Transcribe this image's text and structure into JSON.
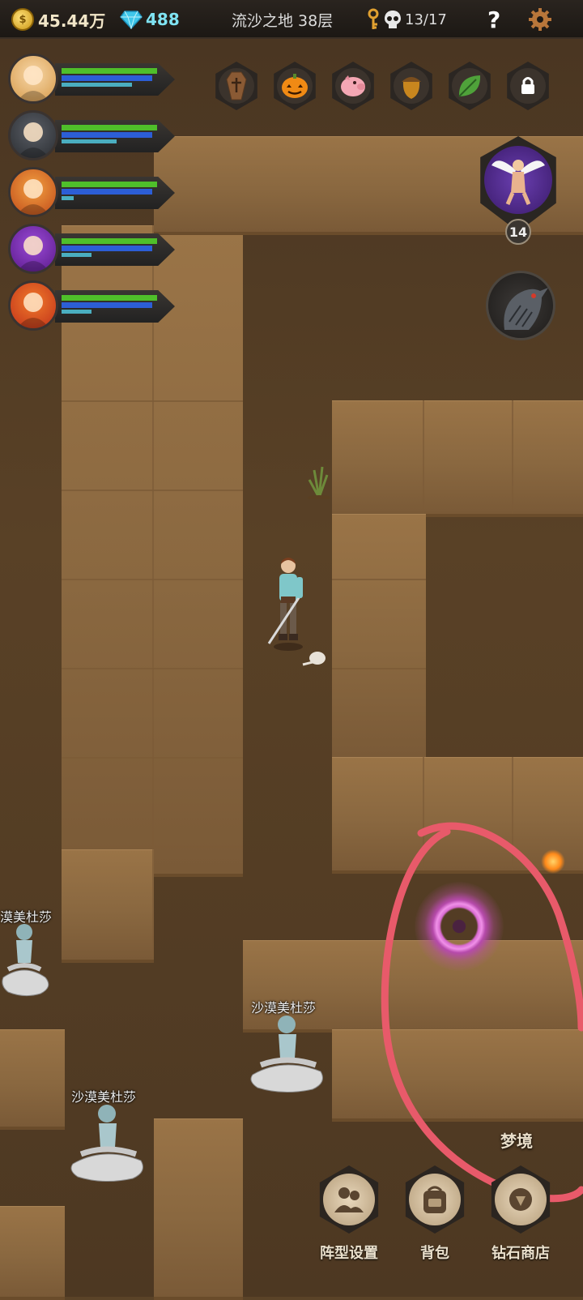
{
  "top_bar": {
    "gold": "45.44万",
    "gold_symbol": "$",
    "diamonds": "488",
    "location": "流沙之地 38层",
    "kills": "13/17",
    "help": "?"
  },
  "heroes": [
    {
      "name": "hero-1",
      "hp": 0.95,
      "mp": 0.9,
      "xp": 0.7
    },
    {
      "name": "hero-2",
      "hp": 0.95,
      "mp": 0.9,
      "xp": 0.55
    },
    {
      "name": "hero-3",
      "hp": 0.95,
      "mp": 0.9,
      "xp": 0.12
    },
    {
      "name": "hero-4",
      "hp": 0.95,
      "mp": 0.9,
      "xp": 0.3
    },
    {
      "name": "hero-5",
      "hp": 0.95,
      "mp": 0.9,
      "xp": 0.3
    }
  ],
  "skills": [
    "coffin-icon",
    "pumpkin-icon",
    "pig-icon",
    "acorn-icon",
    "leaf-icon",
    "lock-icon"
  ],
  "companion_level": "14",
  "enemies": [
    {
      "name": "漠美杜莎"
    },
    {
      "name": "沙漠美杜莎"
    },
    {
      "name": "沙漠美杜莎"
    }
  ],
  "portal_label": "梦境",
  "buttons": [
    {
      "label": "阵型设置",
      "icon": "formation-icon"
    },
    {
      "label": "背包",
      "icon": "backpack-icon"
    },
    {
      "label": "钻石商店",
      "icon": "diamond-shop-icon"
    }
  ],
  "colors": {
    "annotation": "#e85a6a",
    "hp": "#4fbf2a",
    "mp": "#2c5ed6",
    "xp": "#4aaec0"
  }
}
